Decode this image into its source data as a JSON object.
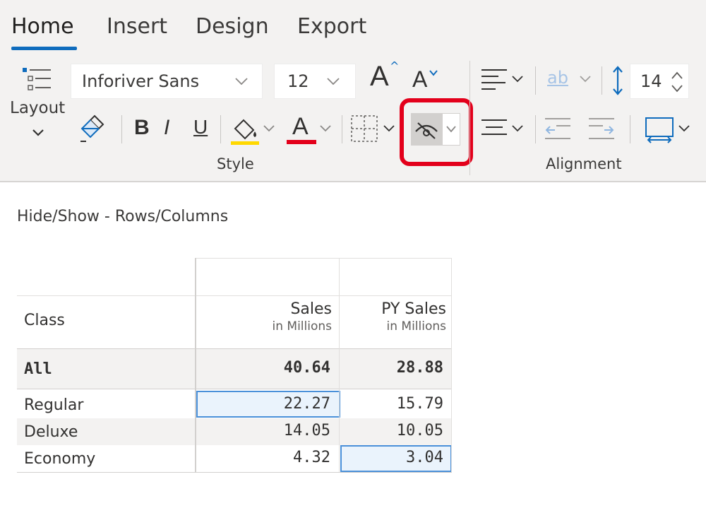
{
  "ribbon": {
    "tabs": [
      {
        "label": "Home",
        "active": true
      },
      {
        "label": "Insert",
        "active": false
      },
      {
        "label": "Design",
        "active": false
      },
      {
        "label": "Export",
        "active": false
      }
    ],
    "layout_label": "Layout",
    "font_family": "Inforiver Sans",
    "font_size": "12",
    "line_spacing": "14",
    "bold_label": "B",
    "italic_label": "I",
    "underline_label": "U",
    "font_color_label": "A",
    "grow_label": "A",
    "shrink_label": "A",
    "wrap_label": "ab",
    "groups": {
      "style": "Style",
      "alignment": "Alignment"
    },
    "colors": {
      "accent": "#0f6cbd",
      "highlight_fill": "#ffd800",
      "font_color": "#e3001b",
      "callout": "#e3001b"
    }
  },
  "content": {
    "heading": "Hide/Show - Rows/Columns",
    "table": {
      "row_header": "Class",
      "columns": [
        {
          "title": "Sales",
          "subtitle": "in Millions"
        },
        {
          "title": "PY Sales",
          "subtitle": "in Millions"
        }
      ],
      "rows": [
        {
          "label": "All",
          "values": [
            "40.64",
            "28.88"
          ],
          "bold": true
        },
        {
          "label": "Regular",
          "values": [
            "22.27",
            "15.79"
          ],
          "selected": [
            true,
            false
          ]
        },
        {
          "label": "Deluxe",
          "values": [
            "14.05",
            "10.05"
          ],
          "selected": [
            false,
            false
          ]
        },
        {
          "label": "Economy",
          "values": [
            "4.32",
            "3.04"
          ],
          "selected": [
            false,
            true
          ]
        }
      ]
    }
  }
}
